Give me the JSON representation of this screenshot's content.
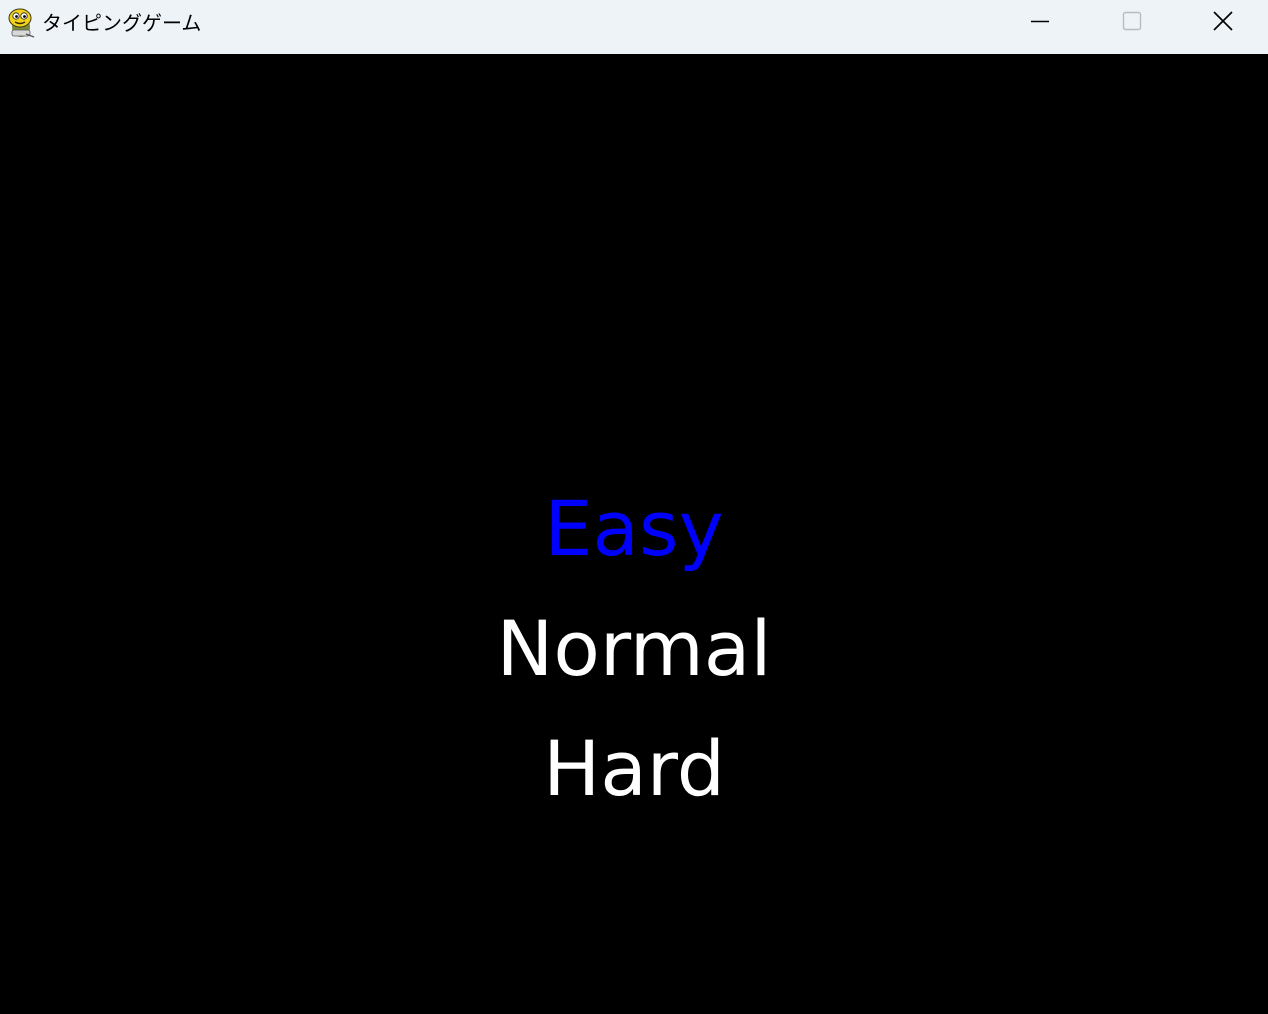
{
  "window": {
    "title": "タイピングゲーム",
    "icon": "pygame-snake-icon",
    "controls": {
      "minimize_icon": "minimize-icon",
      "maximize_icon": "maximize-icon",
      "close_icon": "close-icon"
    }
  },
  "menu": {
    "items": [
      {
        "label": "Easy",
        "selected": true
      },
      {
        "label": "Normal",
        "selected": false
      },
      {
        "label": "Hard",
        "selected": false
      }
    ]
  },
  "colors": {
    "background": "#000000",
    "titlebar": "#eef3f8",
    "selected": "#0000ff",
    "unselected": "#ffffff"
  }
}
